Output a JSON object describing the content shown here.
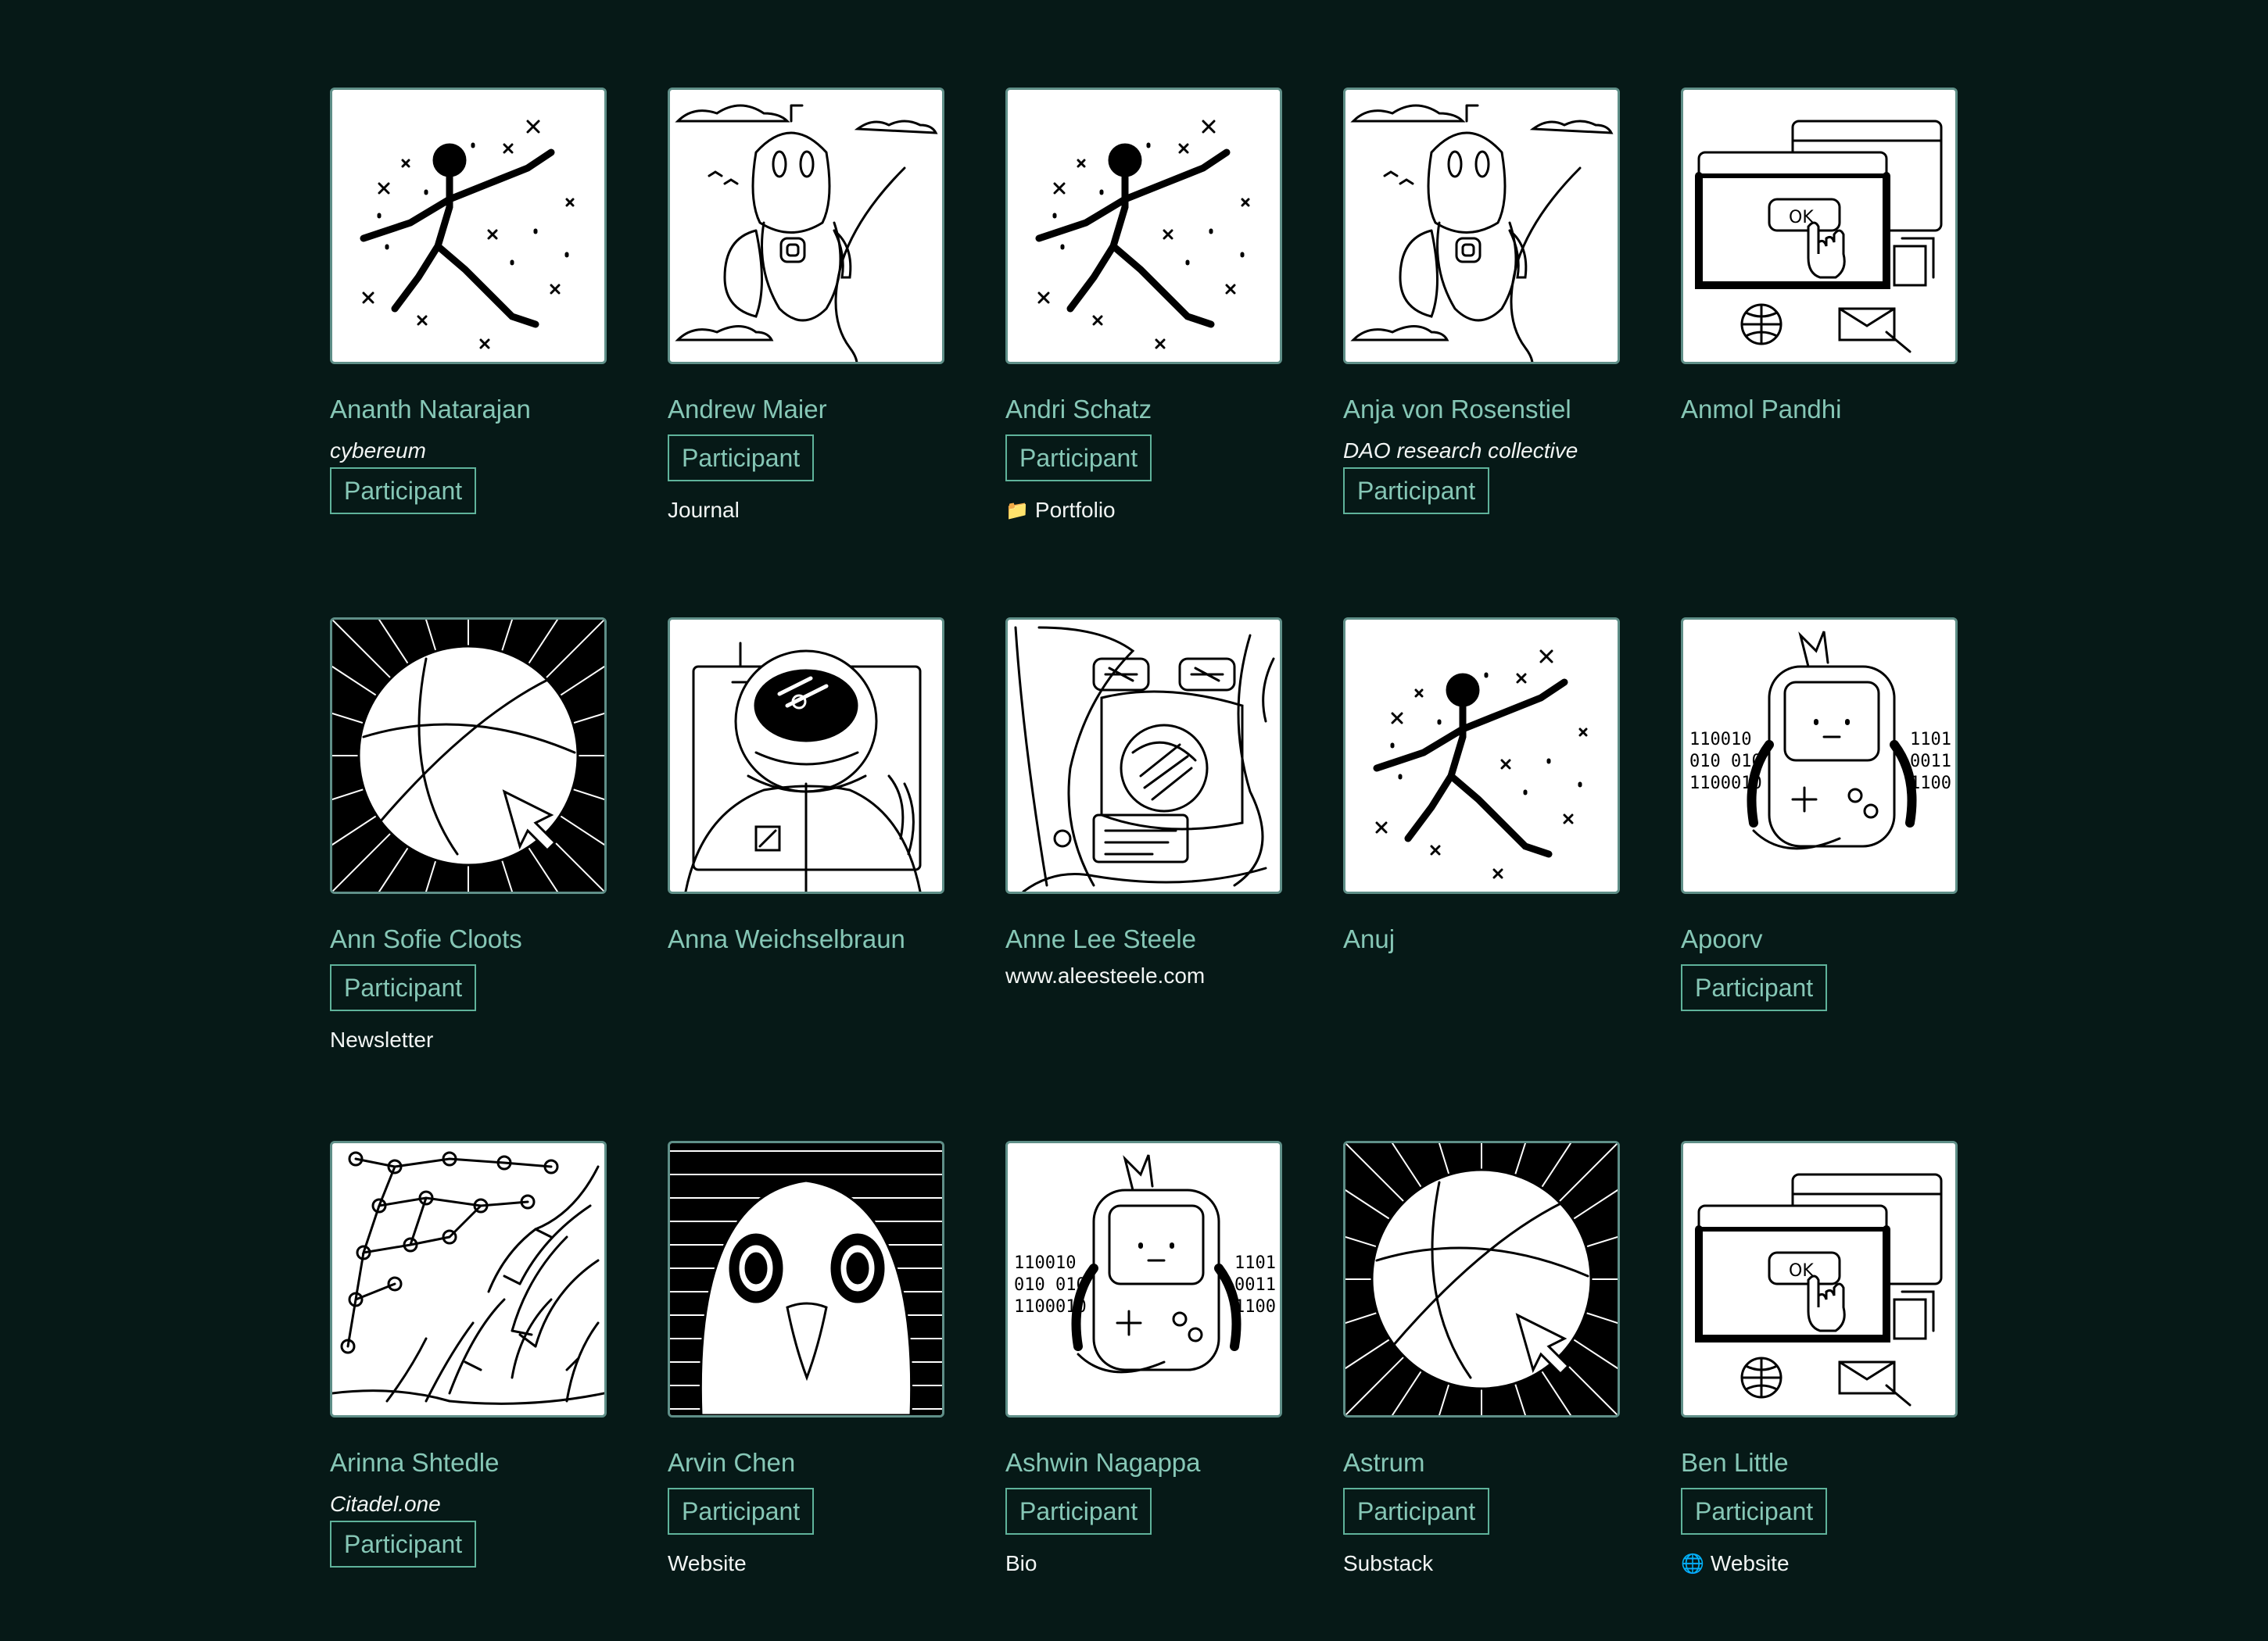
{
  "badge_label": "Participant",
  "participants": [
    {
      "name": "Ananth Natarajan",
      "affiliation": "cybereum",
      "badge": "Participant",
      "art": "space-dancer"
    },
    {
      "name": "Andrew Maier",
      "badge": "Participant",
      "link": "Journal",
      "art": "robot-astronaut"
    },
    {
      "name": "Andri Schatz",
      "badge": "Participant",
      "link": "Portfolio",
      "link_icon": "folder-icon",
      "art": "space-dancer"
    },
    {
      "name": "Anja von Rosenstiel",
      "affiliation": "DAO research collective",
      "badge": "Participant",
      "art": "robot-astronaut"
    },
    {
      "name": "Anmol Pandhi",
      "art": "browser-windows"
    },
    {
      "name": "Ann Sofie Cloots",
      "badge": "Participant",
      "link": "Newsletter",
      "art": "globe-cursor"
    },
    {
      "name": "Anna Weichselbraun",
      "art": "astronaut-helmet"
    },
    {
      "name": "Anne Lee Steele",
      "link": "www.aleesteele.com",
      "art": "abstract-collage"
    },
    {
      "name": "Anuj",
      "art": "space-dancer"
    },
    {
      "name": "Apoorv",
      "badge": "Participant",
      "art": "gameboy-character"
    },
    {
      "name": "Arinna Shtedle",
      "affiliation": "Citadel.one",
      "badge": "Participant",
      "art": "network-roots"
    },
    {
      "name": "Arvin Chen",
      "badge": "Participant",
      "link": "Website",
      "art": "bird-face"
    },
    {
      "name": "Ashwin Nagappa",
      "badge": "Participant",
      "link": "Bio",
      "art": "gameboy-character"
    },
    {
      "name": "Astrum",
      "badge": "Participant",
      "link": "Substack",
      "art": "globe-cursor"
    },
    {
      "name": "Ben Little",
      "badge": "Participant",
      "link": "Website",
      "link_icon": "globe-icon",
      "art": "browser-windows"
    }
  ]
}
